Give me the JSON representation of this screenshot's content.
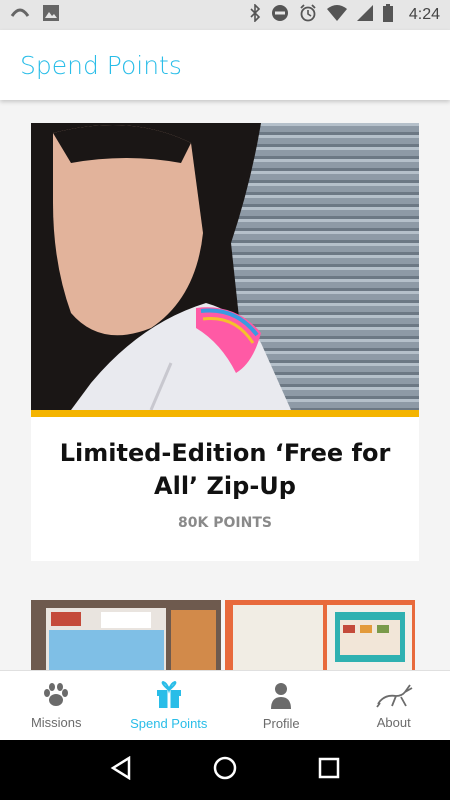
{
  "status_bar": {
    "time": "4:24",
    "icons": [
      "missed-call-icon",
      "image-icon",
      "bluetooth-icon",
      "do-not-disturb-icon",
      "alarm-icon",
      "wifi-icon",
      "signal-icon",
      "battery-icon"
    ]
  },
  "app_bar": {
    "title": "Spend Points"
  },
  "featured_item": {
    "title": "Limited-Edition ‘Free for All’ Zip-Up",
    "points": "80K POINTS",
    "image": "photo-woman-in-white-hoodie"
  },
  "more_items": [
    {
      "image": "photo-guide-booklet"
    },
    {
      "image": "photo-open-magazine"
    }
  ],
  "tab_bar": {
    "tabs": [
      {
        "label": "Missions",
        "icon": "paw-icon",
        "active": false
      },
      {
        "label": "Spend Points",
        "icon": "gift-icon",
        "active": true
      },
      {
        "label": "Profile",
        "icon": "person-icon",
        "active": false
      },
      {
        "label": "About",
        "icon": "rabbit-icon",
        "active": false
      }
    ]
  },
  "colors": {
    "accent": "#29bde8",
    "highlight_bar": "#f4b400",
    "inactive_tab": "#6b6b6b"
  },
  "system_nav": {
    "buttons": [
      "back-icon",
      "home-icon",
      "recents-icon"
    ]
  }
}
